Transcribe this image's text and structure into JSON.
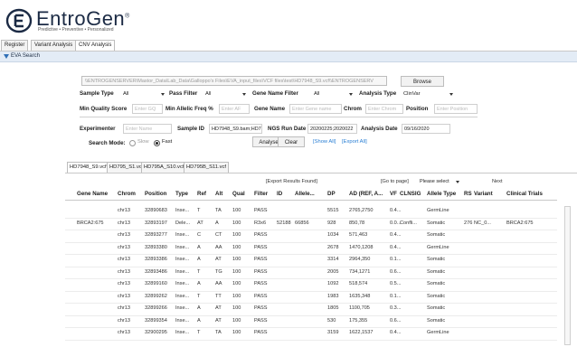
{
  "app": {
    "name": "EntroGen",
    "trademark": "®",
    "tagline": "Predictive • Preventive • Personalized"
  },
  "tabs": [
    "Register",
    "Variant Analysis",
    "CNV Analysis"
  ],
  "section_title": "EVA Search",
  "search": {
    "path_value": "\\\\ENTROGENSERVER\\Mastor_Data\\Lab_Data\\Galloppo's Files\\EVA_input_files\\VCF files\\test\\HD7948_S9.vcf\\\\ENTROGENSERV",
    "browse_label": "Browse",
    "sample_type_label": "Sample Type",
    "sample_type_value": "All",
    "pass_filter_label": "Pass Filter",
    "pass_filter_value": "All",
    "gene_name_filter_label": "Gene Name Filter",
    "gene_name_filter_value": "All",
    "analysis_type_label": "Analysis Type",
    "analysis_type_value": "ClinVar",
    "min_quality_label": "Min Quality Score",
    "min_quality_placeholder": "Enter GQ",
    "min_allelic_label": "Min Allelic Freq %",
    "min_allelic_placeholder": "Enter AF",
    "gene_name_label": "Gene Name",
    "gene_name_placeholder": "Enter Gene name",
    "chrom_label": "Chrom",
    "chrom_placeholder": "Enter Chrom",
    "position_label": "Position",
    "position_placeholder": "Enter Position",
    "experimenter_label": "Experimenter",
    "experimenter_placeholder": "Enter Name",
    "sample_id_label": "Sample ID",
    "sample_id_value": "HD7948_S9.bam;HD795",
    "ngs_run_date_label": "NGS Run Date",
    "ngs_run_date_value": "20200225;2020022",
    "analysis_date_label": "Analysis Date",
    "analysis_date_value": "09/16/2020",
    "search_mode_label": "Search Mode:",
    "mode_slow": "Slow",
    "mode_fast": "Fast",
    "analyse_label": "Analyse",
    "clear_label": "Clear",
    "show_all_label": "[Show All]",
    "export_all_label": "[Export All]"
  },
  "file_tabs": [
    "HD7948_S9.vcf",
    "HD795_S1.vcf",
    "HD795A_S10.vcf",
    "HD795B_S11.vcf"
  ],
  "results": {
    "export_found_label": "[Export Results Found]",
    "go_to_page_label": "[Go to page]",
    "page_select_value": "Please select",
    "next_label": "Next",
    "columns": [
      "Gene Name",
      "Chrom",
      "Position",
      "Type",
      "Ref",
      "Alt",
      "Qual",
      "Filter",
      "ID",
      "Allele...",
      "DP",
      "AD (REF, A...",
      "VF",
      "CLNSIG",
      "Allele Type",
      "RS",
      "Variant",
      "Clinical Trials"
    ],
    "rows": [
      [
        "",
        "chr13",
        "32890683",
        "Inse...",
        "T",
        "TA",
        "100",
        "PASS",
        "",
        "",
        "5515",
        "2765,2750",
        "0.4...",
        "",
        "GermLine",
        "",
        "",
        ""
      ],
      [
        "BRCA2:675",
        "chr13",
        "32893197",
        "Dele...",
        "AT",
        "A",
        "100",
        "R3x6",
        "52188",
        "66856",
        "928",
        "850,78",
        "0.0...",
        "Confli...",
        "Somatic",
        "276",
        "NC_0...",
        "BRCA2:675"
      ],
      [
        "",
        "chr13",
        "32893277",
        "Inse...",
        "C",
        "CT",
        "100",
        "PASS",
        "",
        "",
        "1034",
        "571,463",
        "0.4...",
        "",
        "Somatic",
        "",
        "",
        ""
      ],
      [
        "",
        "chr13",
        "32893380",
        "Inse...",
        "A",
        "AA",
        "100",
        "PASS",
        "",
        "",
        "2678",
        "1470,1208",
        "0.4...",
        "",
        "GermLine",
        "",
        "",
        ""
      ],
      [
        "",
        "chr13",
        "32893386",
        "Inse...",
        "A",
        "AT",
        "100",
        "PASS",
        "",
        "",
        "3314",
        "2964,350",
        "0.1...",
        "",
        "Somatic",
        "",
        "",
        ""
      ],
      [
        "",
        "chr13",
        "32893486",
        "Inse...",
        "T",
        "TG",
        "100",
        "PASS",
        "",
        "",
        "2005",
        "734,1271",
        "0.6...",
        "",
        "Somatic",
        "",
        "",
        ""
      ],
      [
        "",
        "chr13",
        "32899160",
        "Inse...",
        "A",
        "AA",
        "100",
        "PASS",
        "",
        "",
        "1092",
        "518,574",
        "0.5...",
        "",
        "Somatic",
        "",
        "",
        ""
      ],
      [
        "",
        "chr13",
        "32899262",
        "Inse...",
        "T",
        "TT",
        "100",
        "PASS",
        "",
        "",
        "1983",
        "1635,348",
        "0.1...",
        "",
        "Somatic",
        "",
        "",
        ""
      ],
      [
        "",
        "chr13",
        "32899266",
        "Inse...",
        "A",
        "AT",
        "100",
        "PASS",
        "",
        "",
        "1805",
        "1100,705",
        "0.3...",
        "",
        "Somatic",
        "",
        "",
        ""
      ],
      [
        "",
        "chr13",
        "32899354",
        "Inse...",
        "A",
        "AT",
        "100",
        "PASS",
        "",
        "",
        "530",
        "175,355",
        "0.6...",
        "",
        "Somatic",
        "",
        "",
        ""
      ],
      [
        "",
        "chr13",
        "32900295",
        "Inse...",
        "T",
        "TA",
        "100",
        "PASS",
        "",
        "",
        "3159",
        "1622,1537",
        "0.4...",
        "",
        "GermLine",
        "",
        "",
        ""
      ]
    ]
  },
  "colors": {
    "link": "#2a7fd4",
    "section_bar": "#e3ecf6",
    "logo_text": "#1b2a44"
  }
}
